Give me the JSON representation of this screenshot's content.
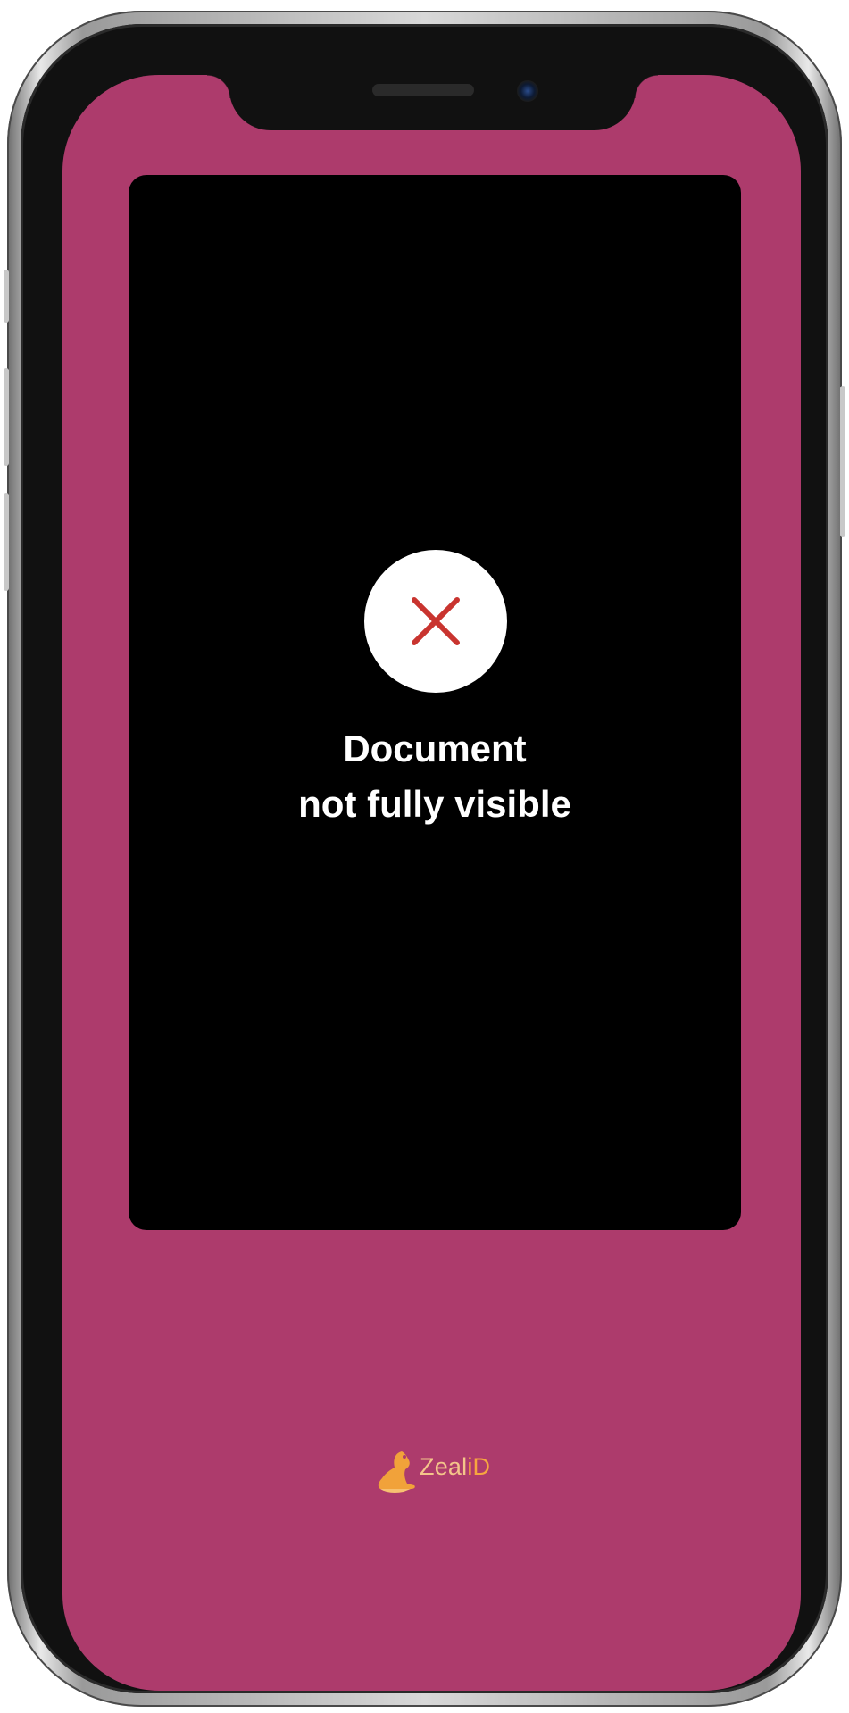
{
  "colors": {
    "screen_background": "#ad3b6c",
    "camera_panel": "#000000",
    "error_icon_stroke": "#c9342f",
    "brand_primary": "#f4c58a",
    "brand_accent": "#f7a63f"
  },
  "device": {
    "icons": {
      "earpiece": "speaker-icon",
      "front_camera": "front-camera-icon"
    }
  },
  "scan_feedback": {
    "status_icon": "close-icon",
    "message_line1": "Document",
    "message_line2": "not fully visible"
  },
  "branding": {
    "logo_icon": "zealid-seal-icon",
    "name_part1": "Zeal",
    "name_part2": "iD"
  }
}
